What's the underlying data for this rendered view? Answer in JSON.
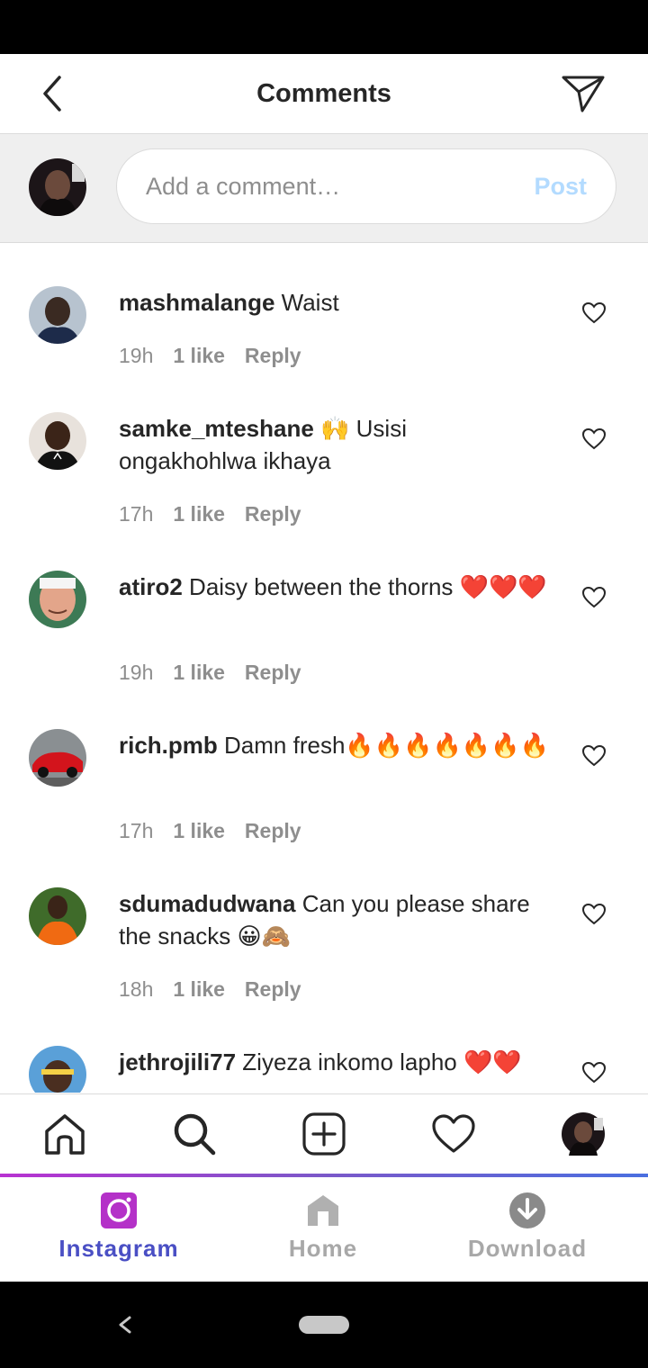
{
  "header": {
    "title": "Comments"
  },
  "composer": {
    "placeholder": "Add a comment…",
    "post_label": "Post"
  },
  "comments": [
    {
      "username": "mashmalange",
      "text": "Waist",
      "emoji": "",
      "time": "19h",
      "likes": "1 like",
      "reply": "Reply"
    },
    {
      "username": "samke_mteshane",
      "text": "Usisi ongakhohlwa ikhaya",
      "emoji": "🙌",
      "time": "17h",
      "likes": "1 like",
      "reply": "Reply"
    },
    {
      "username": "atiro2",
      "text": "Daisy between the thorns",
      "emoji": "❤️❤️❤️",
      "time": "19h",
      "likes": "1 like",
      "reply": "Reply"
    },
    {
      "username": "rich.pmb",
      "text": "Damn fresh",
      "emoji": "🔥🔥🔥🔥🔥🔥🔥",
      "time": "17h",
      "likes": "1 like",
      "reply": "Reply"
    },
    {
      "username": "sdumadudwana",
      "text": "Can you please share the snacks",
      "emoji": "😀🙈",
      "time": "18h",
      "likes": "1 like",
      "reply": "Reply"
    },
    {
      "username": "jethrojili77",
      "text": "Ziyeza inkomo lapho",
      "emoji": "❤️❤️",
      "time": "",
      "likes": "",
      "reply": ""
    }
  ],
  "bottom_nav": {
    "items": [
      {
        "name": "home-icon"
      },
      {
        "name": "search-icon"
      },
      {
        "name": "add-post-icon"
      },
      {
        "name": "heart-icon"
      },
      {
        "name": "profile-avatar"
      }
    ]
  },
  "app_tabs": [
    {
      "label": "Instagram",
      "color": "#4a4fc4",
      "icon": "instagram-icon",
      "active": true
    },
    {
      "label": "Home",
      "color": "#a8a8a8",
      "icon": "home-icon"
    },
    {
      "label": "Download",
      "color": "#a8a8a8",
      "icon": "download-icon"
    }
  ],
  "colors": {
    "post_disabled": "#b3dbff",
    "accent": "#4a4fc4",
    "heart_emoji": "#e0242f",
    "fire": "#ff6a00"
  }
}
